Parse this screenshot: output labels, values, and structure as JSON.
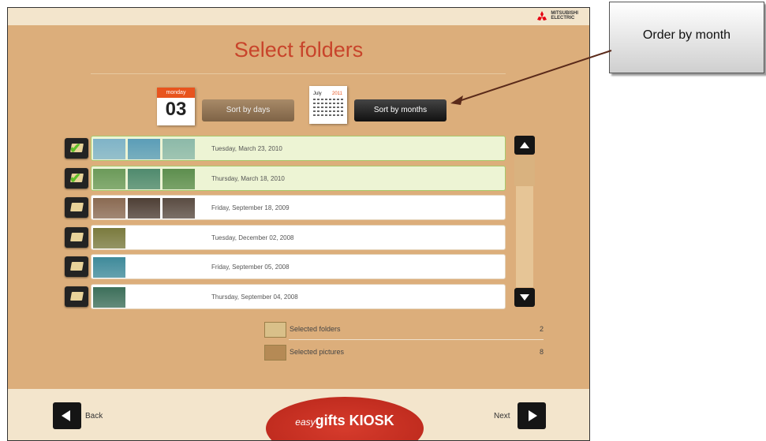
{
  "brand": {
    "name_line1": "MITSUBISHI",
    "name_line2": "ELECTRIC"
  },
  "page_title": "Select folders",
  "sort": {
    "day_calendar": {
      "weekday": "monday",
      "day": "03"
    },
    "days_label": "Sort by days",
    "month_calendar": {
      "month": "July",
      "year": "2011"
    },
    "months_label": "Sort by months"
  },
  "folders": [
    {
      "date": "Tuesday, March 23, 2010",
      "selected": true,
      "thumbs": [
        "#7fb3c8",
        "#5b9db8",
        "#8cb9a9"
      ]
    },
    {
      "date": "Thursday, March 18, 2010",
      "selected": true,
      "thumbs": [
        "#6b9a5a",
        "#4f8a6e",
        "#5d8e4e"
      ]
    },
    {
      "date": "Friday, September 18, 2009",
      "selected": false,
      "thumbs": [
        "#8a6a52",
        "#4e3f35",
        "#5a4c42"
      ]
    },
    {
      "date": "Tuesday, December 02, 2008",
      "selected": false,
      "thumbs": [
        "#7a7a3e"
      ]
    },
    {
      "date": "Friday, September 05, 2008",
      "selected": false,
      "thumbs": [
        "#3f8a9a"
      ]
    },
    {
      "date": "Thursday, September 04, 2008",
      "selected": false,
      "thumbs": [
        "#3d6f5a"
      ]
    }
  ],
  "summary": {
    "selected_folders_label": "Selected folders",
    "selected_folders_value": "2",
    "selected_pictures_label": "Selected pictures",
    "selected_pictures_value": "8"
  },
  "nav": {
    "back_label": "Back",
    "next_label": "Next"
  },
  "logo": {
    "script": "easy",
    "word1": "gifts",
    "word2": "KIOSK"
  },
  "callout": {
    "text": "Order by month"
  },
  "colors": {
    "accent_title": "#c8442b",
    "selected_row": "#edf4d4",
    "check": "#5fbf2a"
  }
}
